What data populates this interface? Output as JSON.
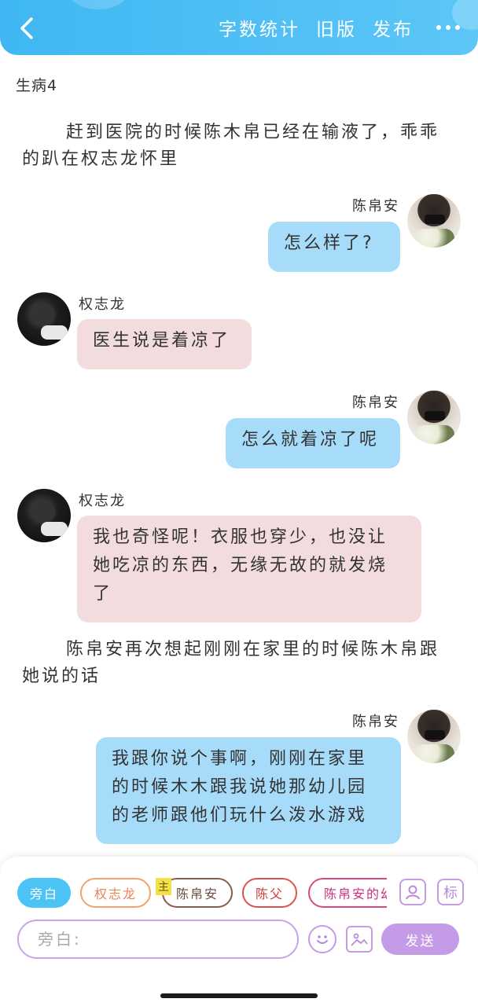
{
  "header": {
    "back_icon": "chevron-left-icon",
    "word_count": "字数统计",
    "old_version": "旧版",
    "publish": "发布",
    "more_icon": "more-dots-icon",
    "accent_color": "#4cc0f5"
  },
  "chapter": {
    "title": "生病4"
  },
  "messages": [
    {
      "type": "narration",
      "text": "赶到医院的时候陈木帛已经在输液了，乖乖的趴在权志龙怀里"
    },
    {
      "type": "right",
      "name": "陈帛安",
      "text": "怎么样了?"
    },
    {
      "type": "left",
      "name": "权志龙",
      "text": "医生说是着凉了"
    },
    {
      "type": "right",
      "name": "陈帛安",
      "text": "怎么就着凉了呢"
    },
    {
      "type": "left",
      "name": "权志龙",
      "text": "我也奇怪呢！衣服也穿少，也没让她吃凉的东西，无缘无故的就发烧了"
    },
    {
      "type": "narration",
      "text": "陈帛安再次想起刚刚在家里的时候陈木帛跟她说的话"
    },
    {
      "type": "right",
      "name": "陈帛安",
      "text": "我跟你说个事啊，刚刚在家里的时候木木跟我说她那幼儿园的老师跟他们玩什么泼水游戏"
    }
  ],
  "composer": {
    "roles": [
      {
        "label": "旁白",
        "active": true
      },
      {
        "label": "权志龙",
        "active": false
      },
      {
        "label": "陈帛安",
        "active": false
      },
      {
        "label": "陈父",
        "active": false
      },
      {
        "label": "陈帛安的幼",
        "active": false
      }
    ],
    "main_badge": "主",
    "profile_icon": "person-card-icon",
    "tag_label": "标",
    "input_placeholder": "旁白:",
    "emoji_icon": "emoji-icon",
    "image_icon": "image-icon",
    "send": "发送"
  }
}
